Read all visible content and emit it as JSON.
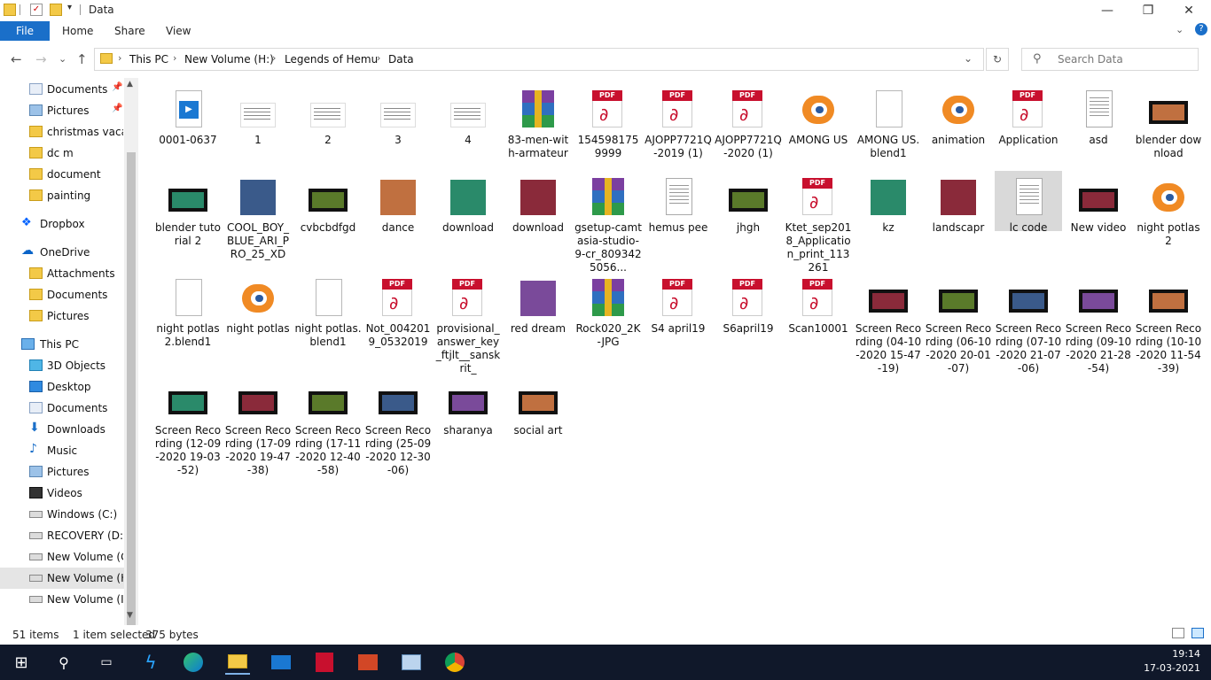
{
  "window": {
    "title": "Data"
  },
  "ribbon": {
    "file": "File",
    "home": "Home",
    "share": "Share",
    "view": "View"
  },
  "address": {
    "crumbs": [
      "This PC",
      "New Volume (H:)",
      "Legends of Hemu",
      "Data"
    ]
  },
  "search": {
    "placeholder": "Search Data"
  },
  "sidebar": {
    "items": [
      {
        "label": "Documents",
        "icon": "documents-icon"
      },
      {
        "label": "Pictures",
        "icon": "pictures-icon"
      },
      {
        "label": "christmas vacati",
        "icon": "folder-icon"
      },
      {
        "label": "dc m",
        "icon": "folder-icon"
      },
      {
        "label": "document",
        "icon": "folder-icon"
      },
      {
        "label": "painting",
        "icon": "folder-icon"
      },
      {
        "label": "Dropbox",
        "icon": "dropbox-icon"
      },
      {
        "label": "OneDrive",
        "icon": "onedrive-icon"
      },
      {
        "label": "Attachments",
        "icon": "folder-icon"
      },
      {
        "label": "Documents",
        "icon": "folder-icon"
      },
      {
        "label": "Pictures",
        "icon": "folder-icon"
      },
      {
        "label": "This PC",
        "icon": "pc-icon"
      },
      {
        "label": "3D Objects",
        "icon": "3d-objects-icon"
      },
      {
        "label": "Desktop",
        "icon": "desktop-icon"
      },
      {
        "label": "Documents",
        "icon": "documents-icon"
      },
      {
        "label": "Downloads",
        "icon": "downloads-icon"
      },
      {
        "label": "Music",
        "icon": "music-icon"
      },
      {
        "label": "Pictures",
        "icon": "pictures-icon"
      },
      {
        "label": "Videos",
        "icon": "videos-icon"
      },
      {
        "label": "Windows (C:)",
        "icon": "drive-icon"
      },
      {
        "label": "RECOVERY (D:)",
        "icon": "drive-icon"
      },
      {
        "label": "New Volume (G:",
        "icon": "drive-icon"
      },
      {
        "label": "New Volume (H:",
        "icon": "drive-icon"
      },
      {
        "label": "New Volume (I:)",
        "icon": "drive-icon"
      }
    ]
  },
  "files": [
    {
      "name": "0001-0637",
      "type": "media"
    },
    {
      "name": "1",
      "type": "thumb"
    },
    {
      "name": "2",
      "type": "thumb"
    },
    {
      "name": "3",
      "type": "thumb"
    },
    {
      "name": "4",
      "type": "thumb"
    },
    {
      "name": "83-men-with-armateur",
      "type": "rar"
    },
    {
      "name": "1545981759999",
      "type": "pdf"
    },
    {
      "name": "AJOPP7721Q-2019 (1)",
      "type": "pdf"
    },
    {
      "name": "AJOPP7721Q-2020 (1)",
      "type": "pdf"
    },
    {
      "name": "AMONG US",
      "type": "blend"
    },
    {
      "name": "AMONG US.blend1",
      "type": "doc"
    },
    {
      "name": "animation",
      "type": "blend"
    },
    {
      "name": "Application",
      "type": "pdf"
    },
    {
      "name": "asd",
      "type": "txt"
    },
    {
      "name": "blender download",
      "type": "video"
    },
    {
      "name": "blender tutorial 2",
      "type": "video"
    },
    {
      "name": "COOL_BOY_BLUE_ARI_PRO_25_XD",
      "type": "img"
    },
    {
      "name": "cvbcbdfgd",
      "type": "video"
    },
    {
      "name": "dance",
      "type": "img"
    },
    {
      "name": "download",
      "type": "img"
    },
    {
      "name": "download",
      "type": "img"
    },
    {
      "name": "gsetup-camtasia-studio-9-cr_8093425056...",
      "type": "rar"
    },
    {
      "name": "hemus pee",
      "type": "txt"
    },
    {
      "name": "jhgh",
      "type": "video"
    },
    {
      "name": "Ktet_sep2018_Application_print_113261",
      "type": "pdf"
    },
    {
      "name": "kz",
      "type": "img"
    },
    {
      "name": "landscapr",
      "type": "img"
    },
    {
      "name": "lc code",
      "type": "txt"
    },
    {
      "name": "New video",
      "type": "video"
    },
    {
      "name": "night potlas 2",
      "type": "blend"
    },
    {
      "name": "night potlas 2.blend1",
      "type": "doc"
    },
    {
      "name": "night potlas",
      "type": "blend"
    },
    {
      "name": "night potlas.blend1",
      "type": "doc"
    },
    {
      "name": "Not_0042019_0532019",
      "type": "pdf"
    },
    {
      "name": "provisional_answer_key_ftjlt__sanskrit_",
      "type": "pdf"
    },
    {
      "name": "red dream",
      "type": "img"
    },
    {
      "name": "Rock020_2K-JPG",
      "type": "rar"
    },
    {
      "name": "S4 april19",
      "type": "pdf"
    },
    {
      "name": "S6april19",
      "type": "pdf"
    },
    {
      "name": "Scan10001",
      "type": "pdf"
    },
    {
      "name": "Screen Recording (04-10-2020 15-47-19)",
      "type": "video"
    },
    {
      "name": "Screen Recording (06-10-2020 20-01-07)",
      "type": "video"
    },
    {
      "name": "Screen Recording (07-10-2020 21-07-06)",
      "type": "video"
    },
    {
      "name": "Screen Recording (09-10-2020 21-28-54)",
      "type": "video"
    },
    {
      "name": "Screen Recording (10-10-2020 11-54-39)",
      "type": "video"
    },
    {
      "name": "Screen Recording (12-09-2020 19-03-52)",
      "type": "video"
    },
    {
      "name": "Screen Recording (17-09-2020 19-47-38)",
      "type": "video"
    },
    {
      "name": "Screen Recording (17-11-2020 12-40-58)",
      "type": "video"
    },
    {
      "name": "Screen Recording (25-09-2020 12-30-06)",
      "type": "video"
    },
    {
      "name": "sharanya",
      "type": "video"
    },
    {
      "name": "social art",
      "type": "video"
    }
  ],
  "status": {
    "count": "51 items",
    "selection": "1 item selected",
    "size": "375 bytes"
  },
  "clock": {
    "time": "19:14",
    "date": "17-03-2021"
  },
  "colors": {
    "accent": "#1a6fc9",
    "selection": "#cce8ff",
    "taskbar": "#10182a"
  }
}
